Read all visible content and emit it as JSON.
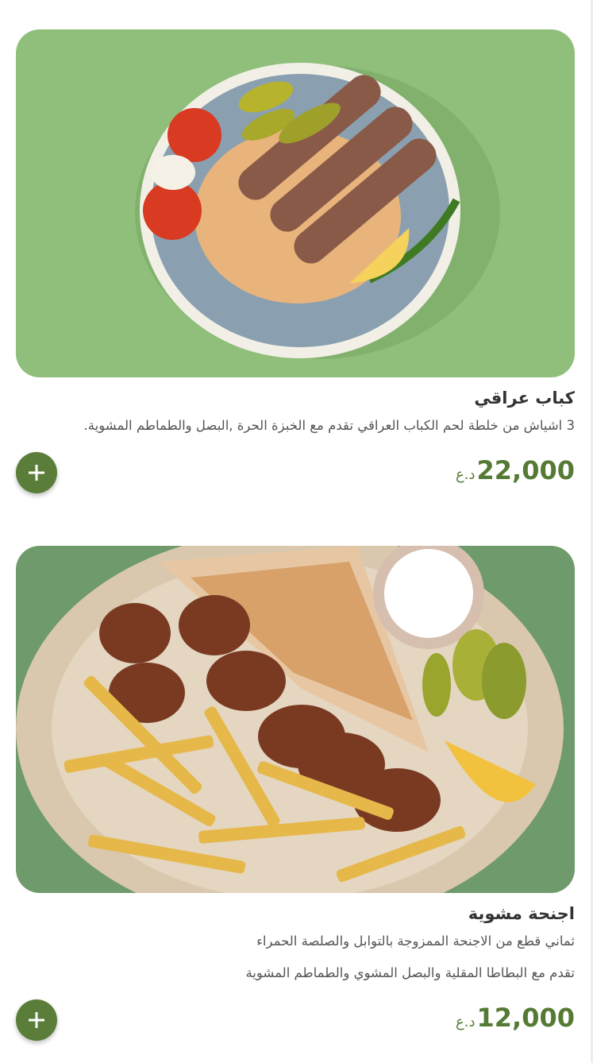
{
  "items": [
    {
      "name": "كباب عراقي",
      "descriptions": [
        "3 اشياش من خلطة لحم الكباب العراقي تقدم مع الخبزة الحرة ,البصل والطماطم المشوية."
      ],
      "price": "22,000",
      "currency": "د.ع",
      "photo_icon": "kebab-plate-photo",
      "background_color": "#8fbf7a"
    },
    {
      "name": "اجنحة مشوية",
      "descriptions": [
        "ثماني قطع من الاجنحة الممزوجة بالتوابل والصلصة الحمراء",
        "تقدم مع البطاطا المقلية والبصل المشوي والطماطم المشوية"
      ],
      "price": "12,000",
      "currency": "د.ع",
      "photo_icon": "grilled-wings-plate-photo",
      "background_color": "#6f9a6c"
    }
  ],
  "accent_color": "#5a7e3a"
}
